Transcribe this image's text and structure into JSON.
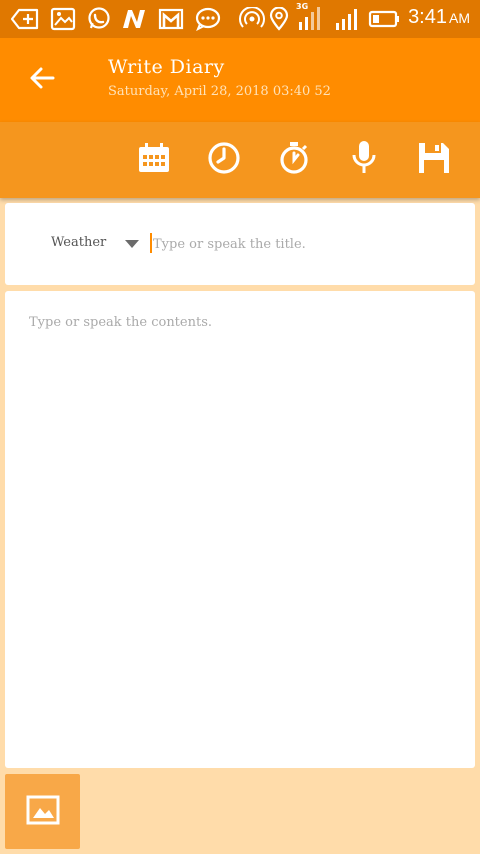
{
  "status_bar": {
    "time": "3:41",
    "am_pm": "AM",
    "network_label": "3G",
    "icons": [
      "add-tab-icon",
      "image-icon",
      "whatsapp-icon",
      "n-app-icon",
      "gmail-icon",
      "chat-icon",
      "hotspot-icon",
      "location-icon",
      "signal-3g-icon",
      "signal-icon",
      "battery-icon"
    ]
  },
  "app_bar": {
    "title": "Write Diary",
    "subtitle": "Saturday, April 28, 2018 03:40 52",
    "back_icon": "arrow-left-icon"
  },
  "toolbar": {
    "icons": [
      "calendar-icon",
      "clock-icon",
      "stopwatch-icon",
      "microphone-icon",
      "save-icon"
    ]
  },
  "title_section": {
    "weather_label": "Weather",
    "title_placeholder": "Type or speak the title."
  },
  "content_section": {
    "content_placeholder": "Type or speak the contents."
  },
  "footer": {
    "image_button_icon": "image-icon"
  },
  "colors": {
    "status_bar": "#E07800",
    "app_bar": "#FF8C00",
    "toolbar": "#F5961E",
    "background": "#FFDCAA",
    "accent": "#FF8C00"
  }
}
